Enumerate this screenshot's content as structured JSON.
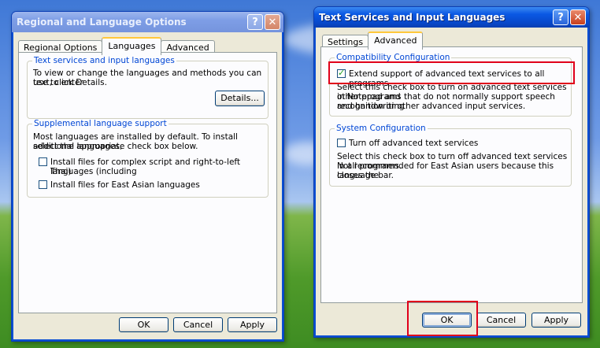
{
  "left_window": {
    "title": "Regional and Language Options",
    "help_glyph": "?",
    "close_glyph": "✕",
    "tabs": [
      "Regional Options",
      "Languages",
      "Advanced"
    ],
    "active_tab": "Languages",
    "group1": {
      "title": "Text services and input languages",
      "desc_line1": "To view or change the languages and methods you can use to enter",
      "desc_line2": "text, click Details.",
      "details_button": "Details..."
    },
    "group2": {
      "title": "Supplemental language support",
      "desc_line1": "Most languages are installed by default. To install additional languages,",
      "desc_line2": "select the appropriate check box below.",
      "check1_line1": "Install files for complex script and right-to-left languages (including",
      "check1_line2": "Thai)",
      "check2": "Install files for East Asian languages"
    },
    "buttons": {
      "ok": "OK",
      "cancel": "Cancel",
      "apply": "Apply"
    }
  },
  "right_window": {
    "title": "Text Services and Input Languages",
    "help_glyph": "?",
    "close_glyph": "✕",
    "tabs": [
      "Settings",
      "Advanced"
    ],
    "active_tab": "Advanced",
    "compat": {
      "title": "Compatibility Configuration",
      "checkbox_label": "Extend support of advanced text services to all programs",
      "checked": true,
      "desc_line1": "Select this check box to turn on advanced text services in Notepad and",
      "desc_line2": "other programs that do not normally support speech and handwriting",
      "desc_line3": "recognition or other advanced input services."
    },
    "system": {
      "title": "System Configuration",
      "checkbox_label": "Turn off advanced text services",
      "checked": false,
      "desc_line1": "Select this check box to turn off advanced text services in all programs.",
      "desc_line2": "Not recommended for East Asian users because this closes the",
      "desc_line3": "language bar."
    },
    "buttons": {
      "ok": "OK",
      "cancel": "Cancel",
      "apply": "Apply"
    }
  },
  "colors": {
    "highlight": "#e0001a",
    "xp_blue": "#0a58e3",
    "group_title": "#0046d5"
  }
}
